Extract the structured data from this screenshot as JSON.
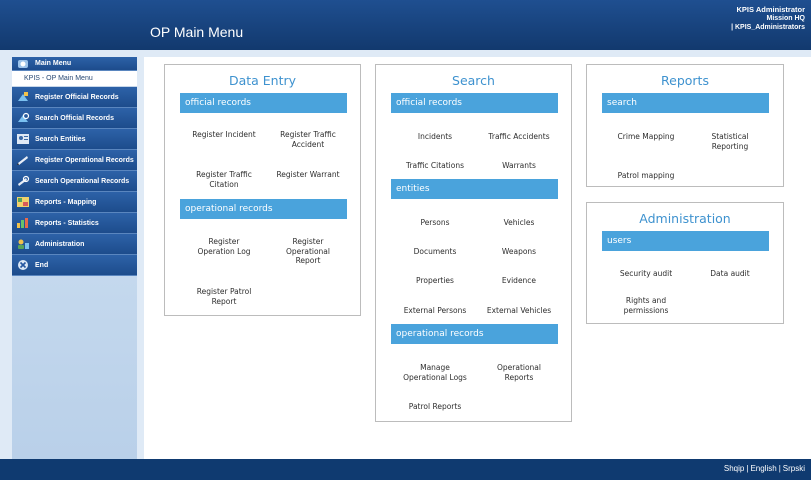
{
  "header": {
    "title": "OP Main Menu",
    "user": [
      "KPIS Administrator",
      "Mission HQ",
      "| KPIS_Administrators"
    ]
  },
  "sidebar": {
    "main_menu": "Main Menu",
    "main_menu_sub": "KPIS - OP Main Menu",
    "items": [
      {
        "label": "Register Official Records",
        "icon": "register-official-records-icon"
      },
      {
        "label": "Search Official Records",
        "icon": "search-official-records-icon"
      },
      {
        "label": "Search Entities",
        "icon": "search-entities-icon"
      },
      {
        "label": "Register Operational Records",
        "icon": "register-operational-records-icon"
      },
      {
        "label": "Search Operational Records",
        "icon": "search-operational-records-icon"
      },
      {
        "label": "Reports - Mapping",
        "icon": "reports-mapping-icon"
      },
      {
        "label": "Reports - Statistics",
        "icon": "reports-statistics-icon"
      },
      {
        "label": "Administration",
        "icon": "administration-icon"
      },
      {
        "label": "End",
        "icon": "end-icon"
      }
    ]
  },
  "data_entry": {
    "title": "Data Entry",
    "official_records": "official records",
    "register_incident": "Register Incident",
    "register_traffic_accident": "Register Traffic\nAccident",
    "register_traffic_citation": "Register Traffic\nCitation",
    "register_warrant": "Register Warrant",
    "operational_records": "operational records",
    "register_operation_log": "Register\nOperation Log",
    "register_operational_report": "Register\nOperational\nReport",
    "register_patrol_report": "Register Patrol\nReport"
  },
  "search": {
    "title": "Search",
    "official_records": "official records",
    "incidents": "Incidents",
    "traffic_accidents": "Traffic Accidents",
    "traffic_citations": "Traffic Citations",
    "warrants": "Warrants",
    "entities": "entities",
    "persons": "Persons",
    "vehicles": "Vehicles",
    "documents": "Documents",
    "weapons": "Weapons",
    "properties": "Properties",
    "evidence": "Evidence",
    "external_persons": "External Persons",
    "external_vehicles": "External Vehicles",
    "operational_records": "operational records",
    "manage_operational_logs": "Manage\nOperational Logs",
    "operational_reports": "Operational\nReports",
    "patrol_reports": "Patrol Reports"
  },
  "reports": {
    "title": "Reports",
    "search": "search",
    "crime_mapping": "Crime Mapping",
    "statistical_reporting": "Statistical\nReporting",
    "patrol_mapping": "Patrol mapping"
  },
  "administration": {
    "title": "Administration",
    "users": "users",
    "security_audit": "Security audit",
    "data_audit": "Data audit",
    "rights_and_permissions": "Rights and\npermissions"
  },
  "footer": {
    "languages": [
      "Shqip",
      "English",
      "Srpski"
    ],
    "separator": "|"
  },
  "colors": {
    "header_bg": "#1a4682",
    "section_bar": "#4aa3dc",
    "panel_title": "#3e92cf",
    "sidebar_item": "#2557a0"
  }
}
